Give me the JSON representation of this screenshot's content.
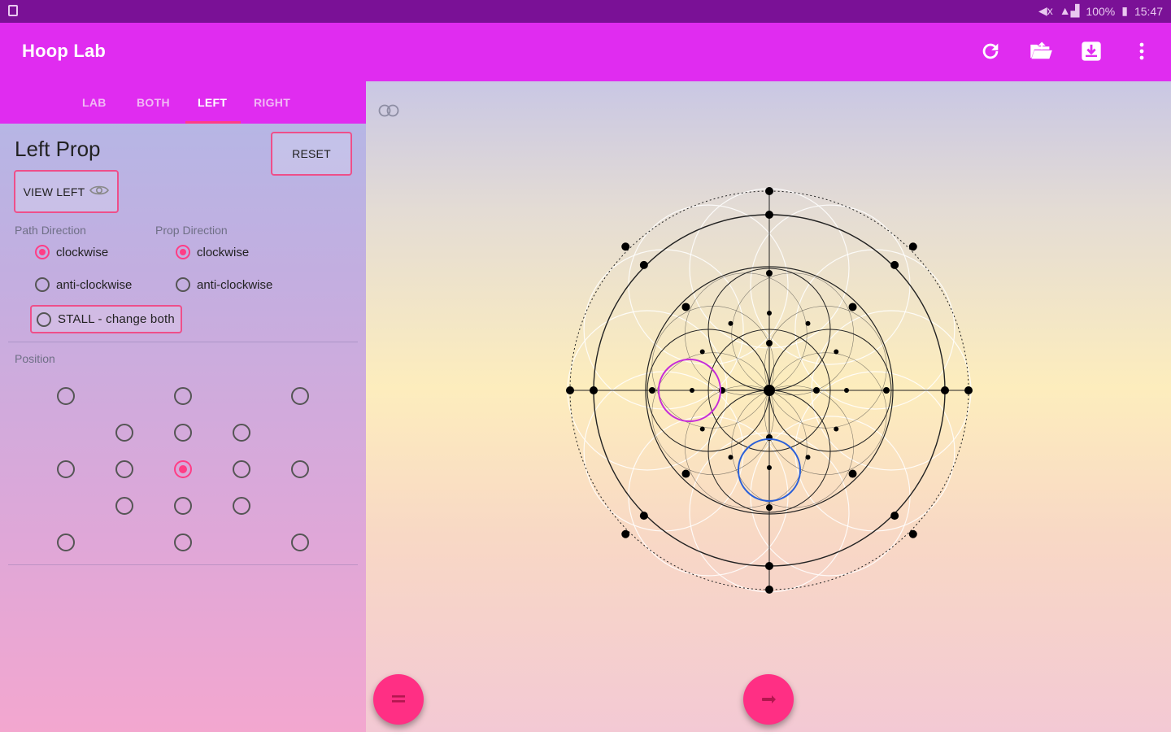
{
  "status_bar": {
    "battery_text": "100%",
    "time": "15:47"
  },
  "app_bar": {
    "title": "Hoop Lab",
    "actions": [
      "refresh-icon",
      "open-folder-icon",
      "save-icon",
      "more-vert-icon"
    ]
  },
  "tabs": [
    {
      "label": "LAB",
      "active": false
    },
    {
      "label": "BOTH",
      "active": false
    },
    {
      "label": "LEFT",
      "active": true
    },
    {
      "label": "RIGHT",
      "active": false
    }
  ],
  "panel": {
    "title": "Left Prop",
    "reset_label": "RESET",
    "view_left_label": "VIEW LEFT",
    "path_direction": {
      "label": "Path Direction",
      "options": [
        {
          "label": "clockwise",
          "checked": true
        },
        {
          "label": "anti-clockwise",
          "checked": false
        }
      ]
    },
    "prop_direction": {
      "label": "Prop Direction",
      "options": [
        {
          "label": "clockwise",
          "checked": true
        },
        {
          "label": "anti-clockwise",
          "checked": false
        }
      ]
    },
    "stall_label": "STALL - change both",
    "position_label": "Position",
    "selected_position": "center"
  },
  "colors": {
    "status_bar": "#7a1196",
    "app_bar": "#e02cf0",
    "accent": "#ff3d86",
    "fab": "#ff2f84",
    "left_hoop": "#c62cd8",
    "right_hoop": "#2a5fd8"
  }
}
